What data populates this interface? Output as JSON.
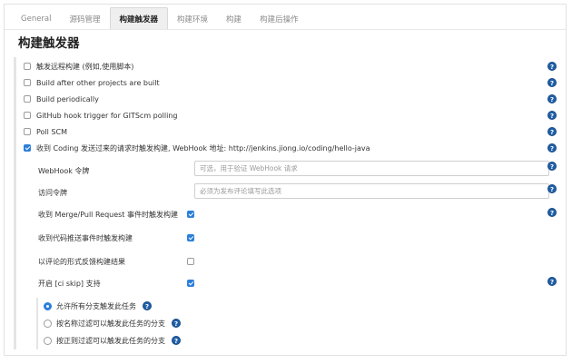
{
  "tabs": [
    {
      "label": "General",
      "active": false
    },
    {
      "label": "源码管理",
      "active": false
    },
    {
      "label": "构建触发器",
      "active": true
    },
    {
      "label": "构建环境",
      "active": false
    },
    {
      "label": "构建",
      "active": false
    },
    {
      "label": "构建后操作",
      "active": false
    }
  ],
  "section_title": "构建触发器",
  "triggers": [
    {
      "label": "触发远程构建 (例如,使用脚本)",
      "checked": false
    },
    {
      "label": "Build after other projects are built",
      "checked": false
    },
    {
      "label": "Build periodically",
      "checked": false
    },
    {
      "label": "GitHub hook trigger for GITScm polling",
      "checked": false
    },
    {
      "label": "Poll SCM",
      "checked": false
    },
    {
      "label": "收到 Coding 发送过来的请求时触发构建, WebHook 地址: http://jenkins.jiong.io/coding/hello-java",
      "checked": true
    }
  ],
  "coding": {
    "webhook_token": {
      "label": "WebHook 令牌",
      "placeholder": "可选，用于验证 WebHook 请求"
    },
    "access_token": {
      "label": "访问令牌",
      "placeholder": "必须为发布评论填写此选项"
    },
    "options": [
      {
        "label": "收到 Merge/Pull Request 事件时触发构建",
        "checked": true
      },
      {
        "label": "收到代码推送事件时触发构建",
        "checked": true
      },
      {
        "label": "以评论的形式反馈构建结果",
        "checked": false
      },
      {
        "label": "开启 [ci skip] 支持",
        "checked": true
      }
    ],
    "branch_filter": [
      {
        "label": "允许所有分支触发此任务",
        "checked": true
      },
      {
        "label": "按名称过滤可以触发此任务的分支",
        "checked": false
      },
      {
        "label": "按正则过滤可以触发此任务的分支",
        "checked": false
      }
    ]
  },
  "help_glyph": "?",
  "colors": {
    "accent": "#2b7fd9",
    "help_icon": "#1f5fa8"
  }
}
